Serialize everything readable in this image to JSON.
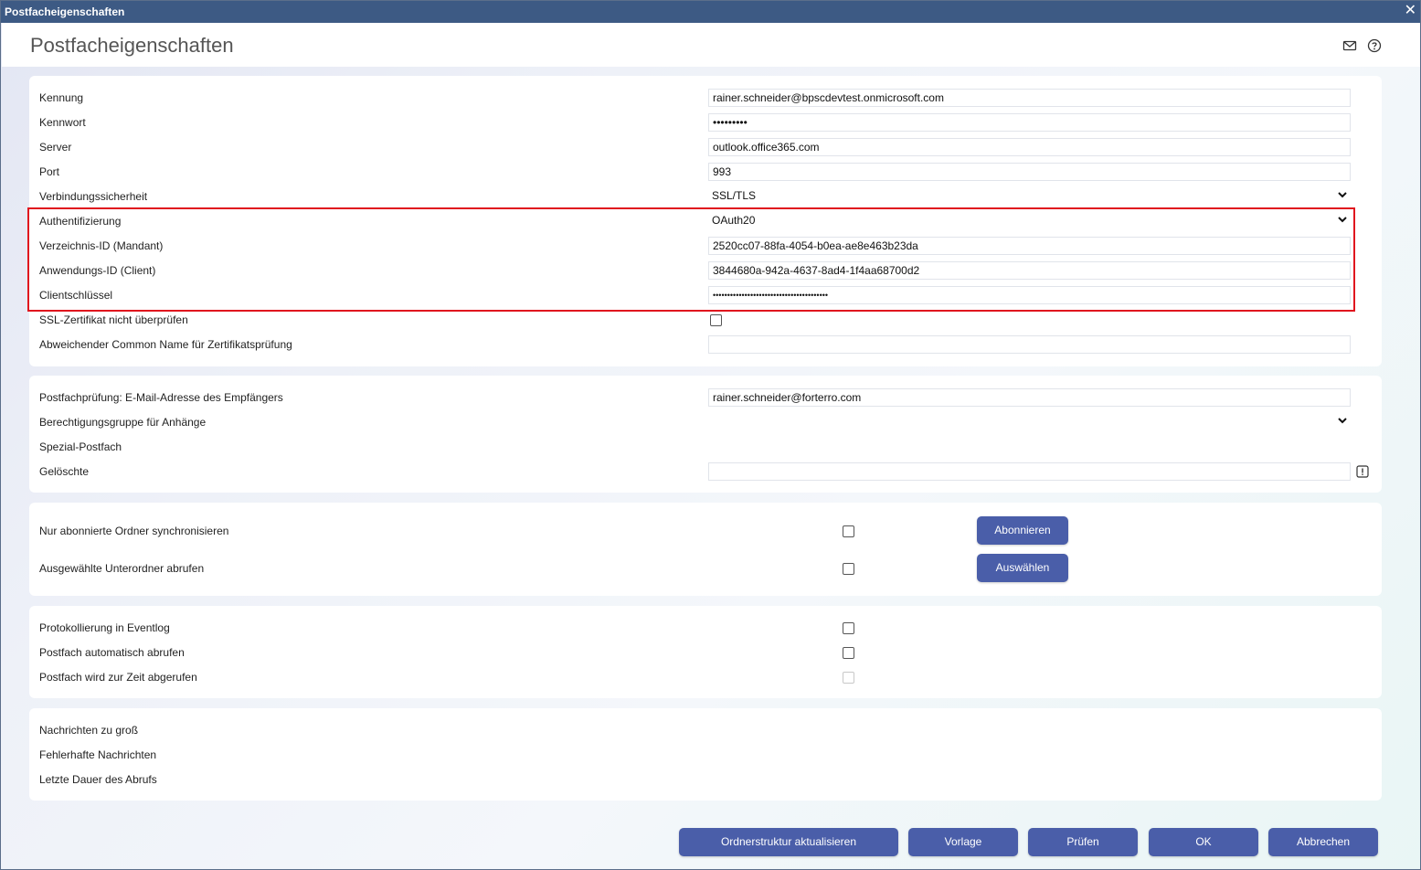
{
  "window": {
    "title": "Postfacheigenschaften",
    "close_glyph": "✕"
  },
  "header": {
    "title": "Postfacheigenschaften",
    "icons": [
      "mail-icon",
      "help-icon"
    ]
  },
  "connection": {
    "kennung": {
      "label": "Kennung",
      "value": "rainer.schneider@bpscdevtest.onmicrosoft.com"
    },
    "kennwort": {
      "label": "Kennwort",
      "value": "•••••••••"
    },
    "server": {
      "label": "Server",
      "value": "outlook.office365.com"
    },
    "port": {
      "label": "Port",
      "value": "993"
    },
    "sicherheit": {
      "label": "Verbindungssicherheit",
      "value": "SSL/TLS"
    },
    "auth": {
      "label": "Authentifizierung",
      "value": "OAuth20"
    },
    "tenant": {
      "label": "Verzeichnis-ID (Mandant)",
      "value": "2520cc07-88fa-4054-b0ea-ae8e463b23da"
    },
    "client": {
      "label": "Anwendungs-ID (Client)",
      "value": "3844680a-942a-4637-8ad4-1f4aa68700d2"
    },
    "secret": {
      "label": "Clientschlüssel",
      "value": "••••••••••••••••••••••••••••••••••••••••"
    },
    "ssl_check": {
      "label": "SSL-Zertifikat nicht überprüfen",
      "checked": false
    },
    "common_name": {
      "label": "Abweichender Common Name für Zertifikatsprüfung",
      "value": ""
    }
  },
  "mailbox": {
    "recipient": {
      "label": "Postfachprüfung: E-Mail-Adresse des Empfängers",
      "value": "rainer.schneider@forterro.com"
    },
    "permgroup": {
      "label": "Berechtigungsgruppe für Anhänge",
      "value": ""
    },
    "special": {
      "label": "Spezial-Postfach"
    },
    "deleted": {
      "label": "Gelöschte",
      "value": ""
    }
  },
  "folders": {
    "subscribed": {
      "label": "Nur abonnierte Ordner synchronisieren",
      "checked": false,
      "button": "Abonnieren"
    },
    "selected": {
      "label": "Ausgewählte Unterordner abrufen",
      "checked": false,
      "button": "Auswählen"
    }
  },
  "logging": {
    "eventlog": {
      "label": "Protokollierung in Eventlog",
      "checked": false
    },
    "auto": {
      "label": "Postfach automatisch abrufen",
      "checked": false
    },
    "running": {
      "label": "Postfach wird zur Zeit abgerufen",
      "checked": false,
      "disabled": true
    }
  },
  "stats": {
    "too_big": {
      "label": "Nachrichten zu groß"
    },
    "faulty": {
      "label": "Fehlerhafte Nachrichten"
    },
    "duration": {
      "label": "Letzte Dauer des Abrufs"
    }
  },
  "footer": {
    "update": "Ordnerstruktur aktualisieren",
    "template": "Vorlage",
    "check": "Prüfen",
    "ok": "OK",
    "cancel": "Abbrechen"
  },
  "colors": {
    "titlebar": "#3d5a84",
    "button": "#4a5ea9",
    "highlight": "#e0141e"
  }
}
